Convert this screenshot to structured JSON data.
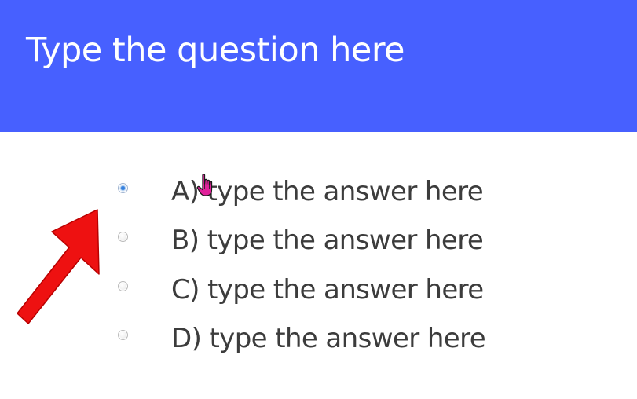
{
  "question": {
    "text": "Type the question here",
    "banner_color": "#4760ff"
  },
  "options": [
    {
      "label": "A) type the answer here",
      "selected": true
    },
    {
      "label": "B) type the answer here",
      "selected": false
    },
    {
      "label": "C) type the answer here",
      "selected": false
    },
    {
      "label": "D) type the answer here",
      "selected": false
    }
  ],
  "annotations": {
    "arrow_icon": "red-arrow-icon",
    "arrow_color": "#ee1111",
    "cursor_icon": "hand-pointer-icon",
    "cursor_color": "#e0219a"
  }
}
